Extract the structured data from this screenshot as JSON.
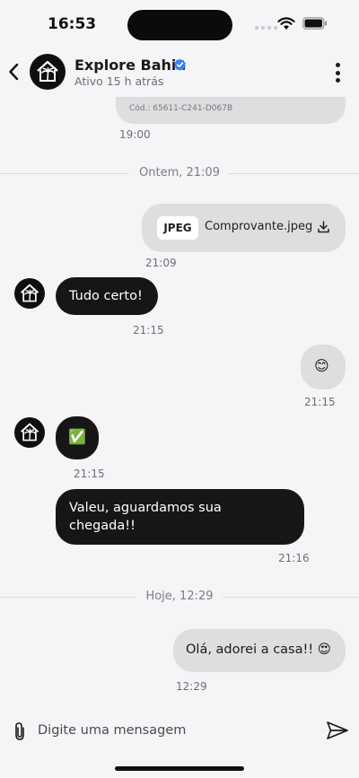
{
  "status_bar": {
    "time": "16:53"
  },
  "header": {
    "contact_name": "Explore Bahia",
    "contact_status": "Ativo 15 h atrás",
    "back_icon": "chevron-left-icon",
    "verified_icon": "verified-badge-icon",
    "more_icon": "more-vertical-icon"
  },
  "messages": {
    "code_text": "Cód.: 65611-C241-D067B",
    "code_time": "19:00",
    "divider_1": "Ontem, 21:09",
    "file": {
      "type": "JPEG",
      "name": "Comprovante.jpeg",
      "time": "21:09"
    },
    "msg_1": {
      "text": "Tudo certo!",
      "time": "21:15"
    },
    "msg_2": {
      "text": "😊",
      "time": "21:15"
    },
    "msg_3": {
      "text": "✅",
      "time": "21:15"
    },
    "msg_4": {
      "line_1": "Valeu, aguardamos sua",
      "line_2": "chegada!!",
      "time": "21:16"
    },
    "divider_2": "Hoje, 12:29",
    "msg_5": {
      "text": "Olá, adorei a casa!! 😍",
      "time": "12:29"
    }
  },
  "composer": {
    "placeholder": "Digite uma mensagem"
  },
  "colors": {
    "accent_verified": "#3b82f6",
    "incoming_bubble": "#161616",
    "outgoing_bubble": "#dedee0"
  }
}
